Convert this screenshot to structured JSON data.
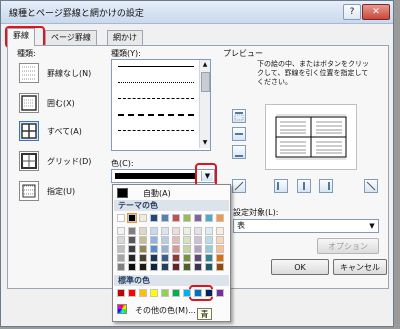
{
  "window": {
    "title": "線種とページ罫線と網かけの設定",
    "help_label": "?",
    "close_label": "✕"
  },
  "tabs": [
    {
      "label": "罫線",
      "active": true
    },
    {
      "label": "ページ罫線",
      "active": false
    },
    {
      "label": "網かけ",
      "active": false
    }
  ],
  "settings": {
    "label": "種類:",
    "items": [
      {
        "label": "罫線なし(N)",
        "selected": false
      },
      {
        "label": "囲む(X)",
        "selected": false
      },
      {
        "label": "すべて(A)",
        "selected": true
      },
      {
        "label": "グリッド(D)",
        "selected": false
      },
      {
        "label": "指定(U)",
        "selected": false
      }
    ]
  },
  "line_style": {
    "label": "種類(Y):"
  },
  "color": {
    "label": "色(C):",
    "value_color": "#000000"
  },
  "preview": {
    "label": "プレビュー",
    "instruction": "下の絵の中、またはボタンをクリックして、罫線を引く位置を指定してください。"
  },
  "apply_to": {
    "label": "設定対象(L):",
    "value": "表"
  },
  "buttons": {
    "options": "オプション(O)...",
    "ok": "OK",
    "cancel": "キャンセル"
  },
  "color_popup": {
    "automatic_label": "自動(A)",
    "theme_colors_label": "テーマの色",
    "standard_colors_label": "標準の色",
    "more_colors_label": "その他の色(M)...",
    "tooltip_text": "青",
    "theme_top_row": [
      "#ffffff",
      "#000000",
      "#eeece1",
      "#1f497d",
      "#4f81bd",
      "#c0504d",
      "#9bbb59",
      "#8064a2",
      "#4bacc6",
      "#f79646"
    ],
    "theme_shades": [
      [
        "#f2f2f2",
        "#7f7f7f",
        "#ddd9c3",
        "#c6d9f0",
        "#dbe5f1",
        "#f2dcdb",
        "#ebf1dd",
        "#e5e0ec",
        "#dbeef3",
        "#fdeada"
      ],
      [
        "#d8d8d8",
        "#595959",
        "#c4bd97",
        "#8db3e2",
        "#b8cce4",
        "#e5b9b7",
        "#d7e3bc",
        "#ccc1d9",
        "#b7dde8",
        "#fbd5b5"
      ],
      [
        "#bfbfbf",
        "#3f3f3f",
        "#938953",
        "#548dd4",
        "#95b3d7",
        "#d99694",
        "#c3d69b",
        "#b2a2c7",
        "#92cddc",
        "#fac08f"
      ],
      [
        "#a5a5a5",
        "#262626",
        "#494429",
        "#17365d",
        "#366092",
        "#953734",
        "#76923c",
        "#5f497a",
        "#31859b",
        "#e36c09"
      ],
      [
        "#7f7f7f",
        "#0c0c0c",
        "#1d1b10",
        "#0f243e",
        "#244061",
        "#632423",
        "#4f6128",
        "#3f3151",
        "#205867",
        "#974806"
      ]
    ],
    "standard": [
      "#c00000",
      "#ff0000",
      "#ffc000",
      "#ffff00",
      "#92d050",
      "#00b050",
      "#00b0f0",
      "#0070c0",
      "#002060",
      "#7030a0"
    ],
    "highlight_color": "#e0141e"
  }
}
